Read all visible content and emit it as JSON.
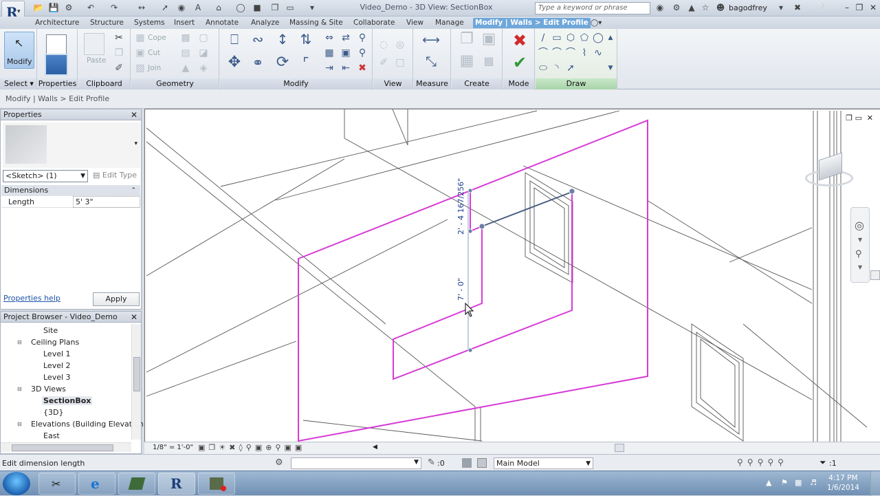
{
  "app": {
    "logo_letter": "R",
    "doc_title": "Video_Demo - 3D View: SectionBox",
    "search_placeholder": "Type a keyword or phrase",
    "username": "bagodfrey"
  },
  "tabs": [
    "Architecture",
    "Structure",
    "Systems",
    "Insert",
    "Annotate",
    "Analyze",
    "Massing & Site",
    "Collaborate",
    "View",
    "Manage",
    "Modify | Walls > Edit Profile"
  ],
  "ribbon": {
    "select": {
      "label": "Modify",
      "panel": "Select"
    },
    "properties": {
      "label": "Properties"
    },
    "clipboard": {
      "panel": "Clipboard",
      "paste": "Paste"
    },
    "geometry": {
      "panel": "Geometry",
      "cope": "Cope",
      "cut": "Cut",
      "join": "Join"
    },
    "modify": {
      "panel": "Modify"
    },
    "view": {
      "panel": "View"
    },
    "measure": {
      "panel": "Measure"
    },
    "create": {
      "panel": "Create"
    },
    "mode": {
      "panel": "Mode"
    },
    "draw": {
      "panel": "Draw"
    }
  },
  "options_bar": {
    "breadcrumb": "Modify | Walls > Edit Profile"
  },
  "properties": {
    "title": "Properties",
    "instance": "<Sketch> (1)",
    "edit_type": "Edit Type",
    "group": "Dimensions",
    "rows": [
      {
        "key": "Length",
        "value": "5'  3\""
      }
    ],
    "help": "Properties help",
    "apply": "Apply"
  },
  "browser": {
    "title": "Project Browser - Video_Demo",
    "items": [
      "Site",
      "Ceiling Plans",
      "Level 1",
      "Level 2",
      "Level 3",
      "3D Views",
      "SectionBox",
      "{3D}",
      "Elevations (Building Elevation",
      "East"
    ]
  },
  "viewport": {
    "dim_upper": "2' - 4 167/256\"",
    "dim_lower": "7' - 0\"",
    "sketch_color": "#d63ad6"
  },
  "view_control": {
    "scale": "1/8\" = 1'-0\""
  },
  "status": {
    "text": "Edit dimension length",
    "count": ":0",
    "model": "Main Model",
    "filter_count": ":1"
  },
  "taskbar": {
    "time": "4:17 PM",
    "date": "1/6/2014"
  }
}
